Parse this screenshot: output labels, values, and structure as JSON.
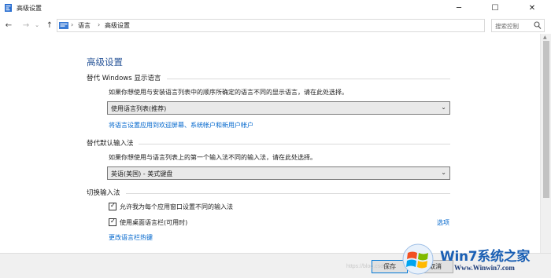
{
  "window": {
    "title": "高级设置",
    "minimize_glyph": "─",
    "maximize_glyph": "☐",
    "close_glyph": "✕"
  },
  "navigation": {
    "back_glyph": "←",
    "forward_glyph": "→",
    "recent_glyph": "⌄",
    "up_glyph": "↑",
    "breadcrumbs": [
      "语言",
      "高级设置"
    ],
    "separator": "›",
    "dropdown_glyph": "⌄",
    "refresh_glyph": "↻"
  },
  "search": {
    "placeholder": "搜索控制"
  },
  "page": {
    "title": "高级设置"
  },
  "display_language": {
    "heading": "替代 Windows 显示语言",
    "description": "如果你想使用与安装语言列表中的顺序所确定的语言不同的显示语言，请在此处选择。",
    "selected": "使用语言列表(推荐)",
    "link": "将语言设置应用到欢迎屏幕、系统帐户和新用户帐户"
  },
  "input_method": {
    "heading": "替代默认输入法",
    "description": "如果你想使用与语言列表上的第一个输入法不同的输入法，请在此处选择。",
    "selected": "英语(美国) - 美式键盘"
  },
  "switching": {
    "heading": "切换输入法",
    "option1": "允许我为每个应用窗口设置不同的输入法",
    "option1_checked": true,
    "option2": "使用桌面语言栏(可用时)",
    "option2_checked": true,
    "options_link": "选项",
    "hotkeys_link": "更改语言栏热键",
    "check_glyph": "✓"
  },
  "footer": {
    "save_label": "保存",
    "cancel_label": "取消"
  },
  "watermark": {
    "brand": "Win7系统之家",
    "url": "Www.Winwin7.com",
    "faint_url": "https://blog.csdn.net"
  },
  "icons": {
    "app": "control-panel-icon",
    "address": "control-panel-icon",
    "search": "search-icon",
    "dropdown": "chevron-down-icon"
  },
  "colors": {
    "title_blue": "#2b579a",
    "link_blue": "#0066cc",
    "watermark_blue": "#1a5fb4"
  }
}
